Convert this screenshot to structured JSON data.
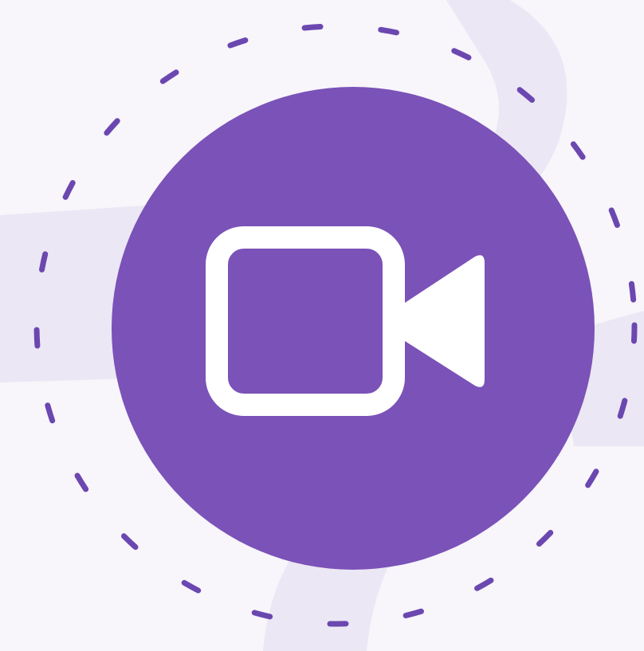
{
  "icon": {
    "name": "video-camera-icon",
    "meaning": "video call"
  },
  "colors": {
    "background": "#F8F5FB",
    "background_shape": "#ECE7F4",
    "accent": "#7A52B8",
    "dash_ring": "#6B47B0",
    "icon_fill": "#FFFFFF"
  }
}
